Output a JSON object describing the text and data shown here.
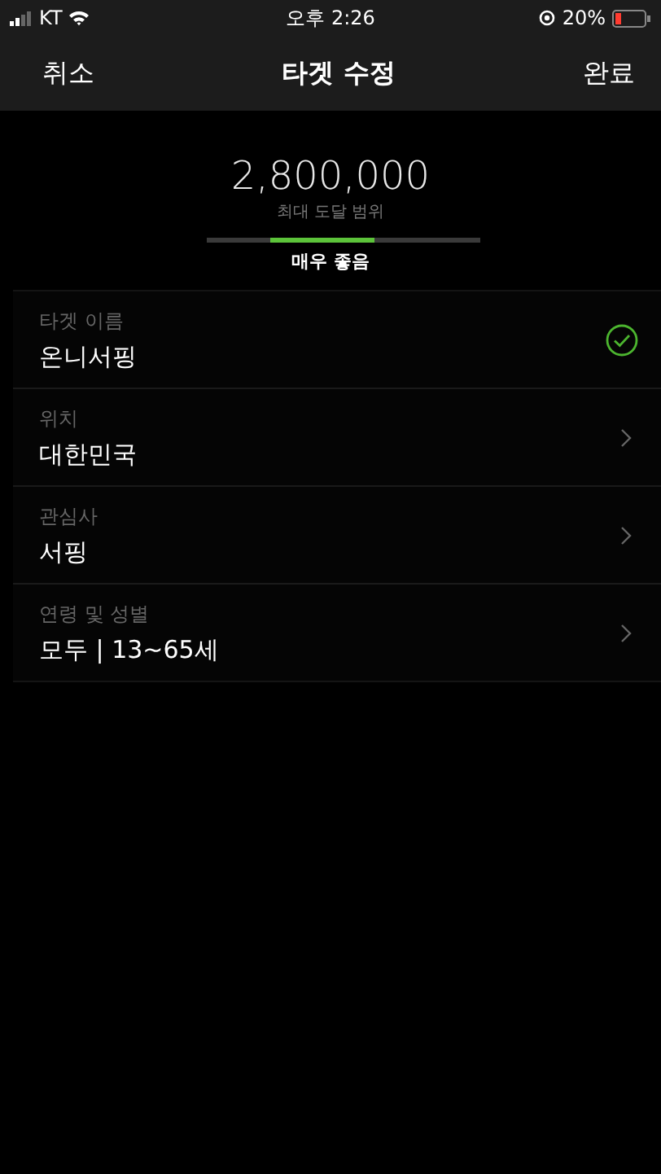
{
  "status_bar": {
    "carrier": "KT",
    "time": "오후 2:26",
    "battery": "20%"
  },
  "nav": {
    "cancel": "취소",
    "title": "타겟 수정",
    "done": "완료"
  },
  "reach": {
    "value": "2,800,000",
    "label": "최대 도달 범위",
    "rating": "매우 좋음",
    "segments": [
      {
        "selected": false
      },
      {
        "selected": true
      },
      {
        "selected": false
      }
    ]
  },
  "fields": [
    {
      "label": "타겟 이름",
      "value": "온니서핑",
      "kind": "check"
    },
    {
      "label": "위치",
      "value": "대한민국",
      "kind": "link"
    },
    {
      "label": "관심사",
      "value": "서핑",
      "kind": "link"
    },
    {
      "label": "연령 및 성별",
      "value": "모두 | 13~65세",
      "kind": "link"
    }
  ]
}
